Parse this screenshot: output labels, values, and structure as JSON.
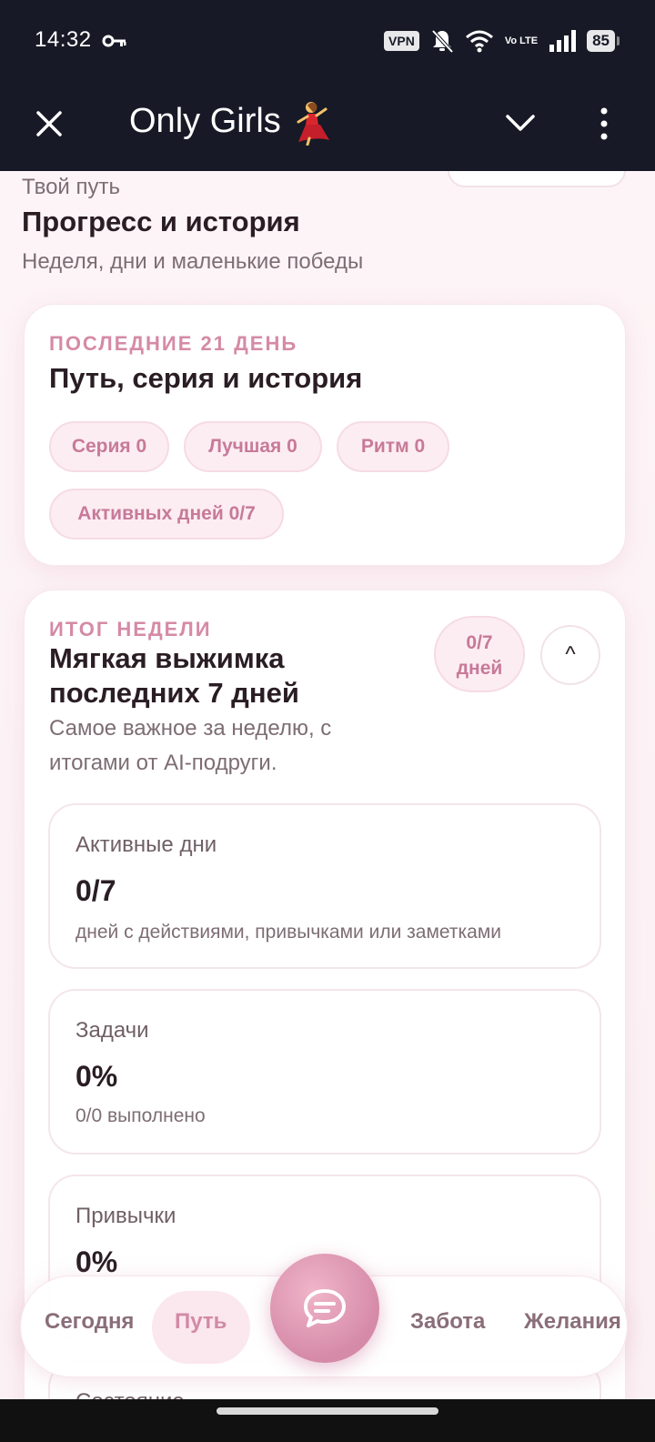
{
  "status_bar": {
    "time": "14:32",
    "vpn": "VPN",
    "network": "Vo LTE",
    "battery": "85"
  },
  "app_bar": {
    "title": "Only Girls",
    "emoji_icon": "dancer-emoji"
  },
  "section": {
    "kicker": "Твой путь",
    "title": "Прогресс и история",
    "subtitle": "Неделя, дни и маленькие победы"
  },
  "history_card": {
    "kicker": "ПОСЛЕДНИЕ 21 ДЕНЬ",
    "title": "Путь, серия и история",
    "chips": [
      "Серия 0",
      "Лучшая 0",
      "Ритм 0",
      "Активных дней 0/7"
    ]
  },
  "week_card": {
    "kicker": "ИТОГ НЕДЕЛИ",
    "title_line1": "Мягкая выжимка",
    "title_line2": "последних 7 дней",
    "badge_line1": "0/7",
    "badge_line2": "дней",
    "collapse_symbol": "^",
    "desc_line1": "Самое важное за неделю, с",
    "desc_line2": "итогами от AI-подруги.",
    "stats": [
      {
        "label": "Активные дни",
        "value": "0/7",
        "desc": "дней с действиями, привычками или заметками"
      },
      {
        "label": "Задачи",
        "value": "0%",
        "desc": "0/0 выполнено"
      },
      {
        "label": "Привычки",
        "value": "0%",
        "desc": ""
      },
      {
        "label": "Состояние",
        "value": "",
        "desc": ""
      }
    ]
  },
  "bottom_nav": {
    "items": [
      "Сегодня",
      "Путь",
      "Забота",
      "Желания"
    ],
    "active": "Путь"
  },
  "colors": {
    "accent": "#d58aa5",
    "dark_bar": "#171a26",
    "chip_bg": "#fcedf2"
  }
}
